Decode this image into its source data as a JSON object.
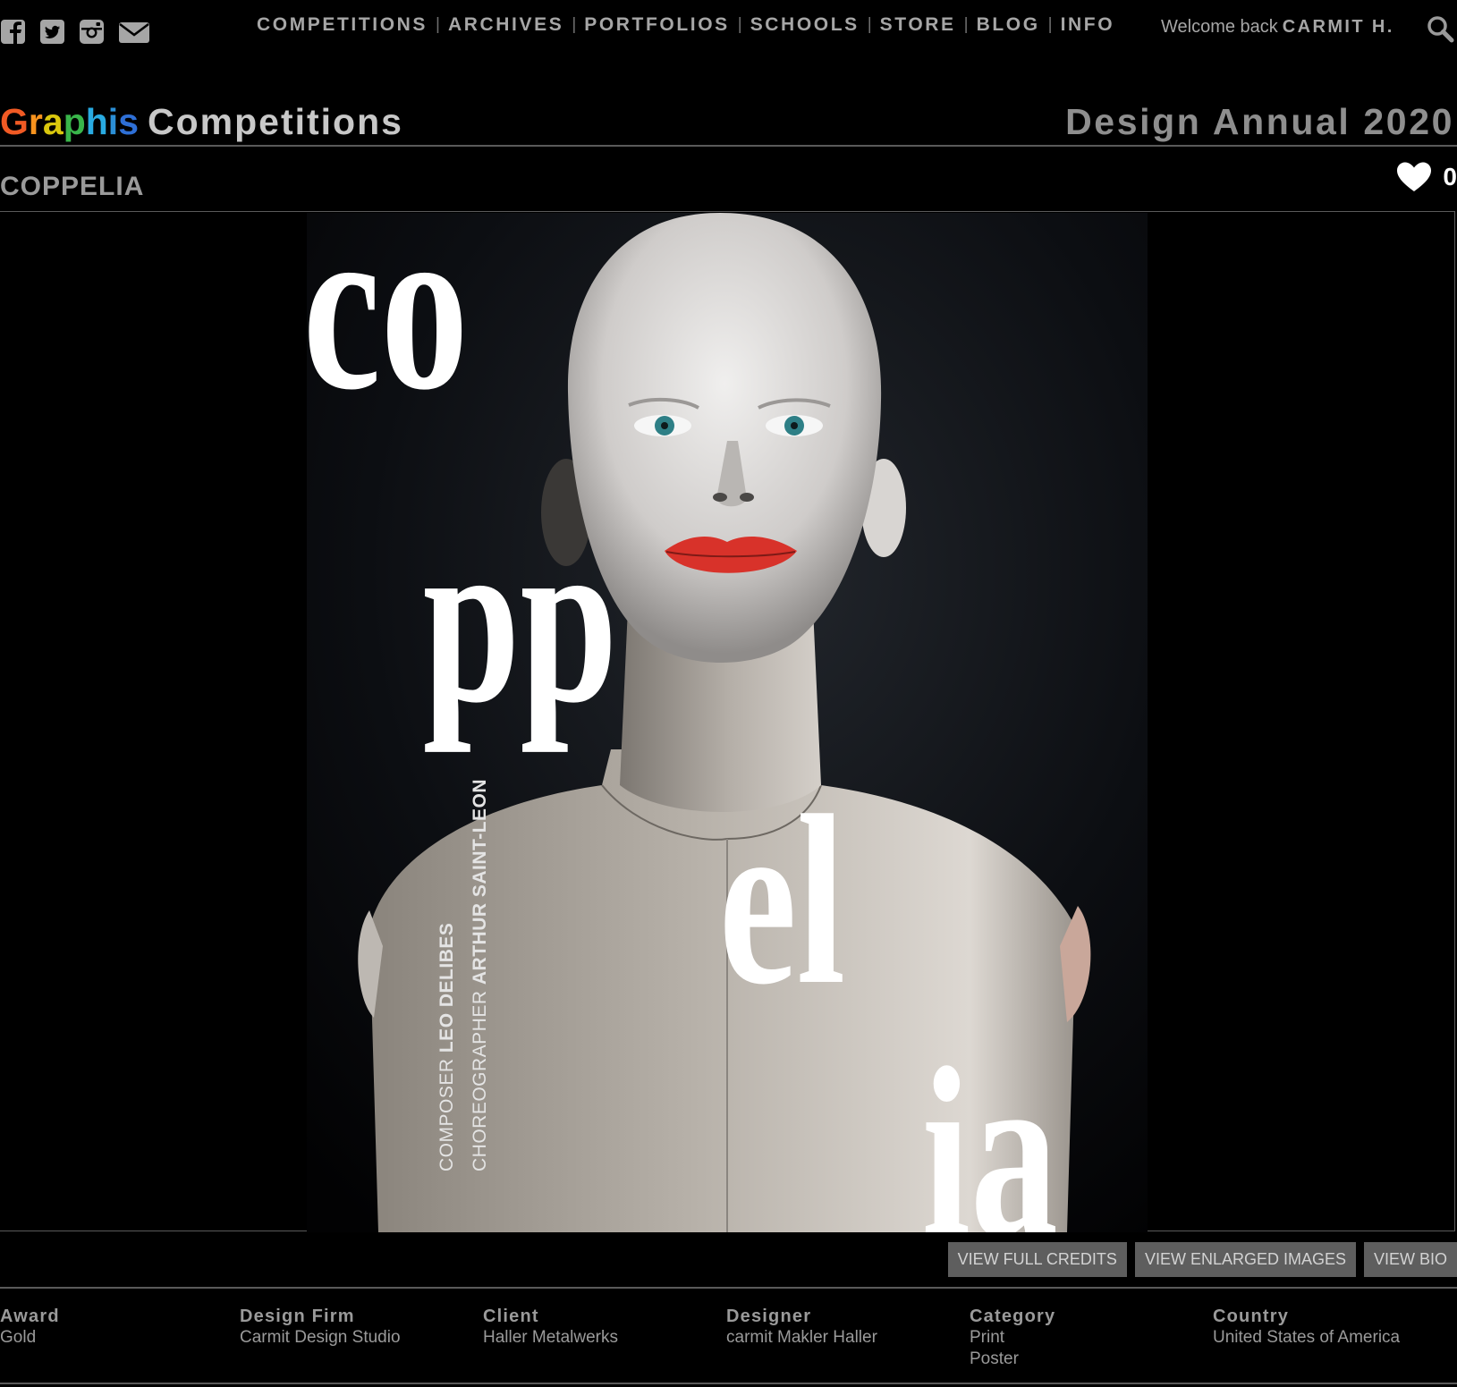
{
  "social": [
    {
      "name": "facebook-icon"
    },
    {
      "name": "twitter-icon"
    },
    {
      "name": "instagram-icon"
    },
    {
      "name": "email-icon"
    }
  ],
  "nav": {
    "items": [
      "COMPETITIONS",
      "ARCHIVES",
      "PORTFOLIOS",
      "SCHOOLS",
      "STORE",
      "BLOG",
      "INFO"
    ],
    "separator": "|",
    "welcome": "Welcome back",
    "user": "CARMIT H."
  },
  "header": {
    "brand_letters": [
      "G",
      "r",
      "a",
      "p",
      "h",
      "i",
      "s"
    ],
    "brand_colors": [
      "#f15a24",
      "#f7931e",
      "#d9c70d",
      "#39b54a",
      "#29abe2",
      "#2b8fd6",
      "#2e6fd6"
    ],
    "title": "Competitions",
    "annual": "Design Annual 2020"
  },
  "entry": {
    "title": "COPPELIA",
    "likes": "0"
  },
  "poster": {
    "letters": [
      "co",
      "pp",
      "el",
      "ia"
    ],
    "composer_label": "COMPOSER",
    "composer": "LEO DELIBES",
    "choreographer_label": "CHOREOGRAPHER",
    "choreographer": "ARTHUR SAINT-LEON",
    "lip_color": "#d8322a",
    "eye_color": "#2e7f86"
  },
  "buttons": {
    "full_credits": "VIEW FULL CREDITS",
    "enlarged": "VIEW ENLARGED IMAGES",
    "bio": "VIEW BIO"
  },
  "credits": [
    {
      "heading": "Award",
      "values": [
        "Gold"
      ]
    },
    {
      "heading": "Design Firm",
      "values": [
        "Carmit Design Studio"
      ]
    },
    {
      "heading": "Client",
      "values": [
        "Haller Metalwerks"
      ]
    },
    {
      "heading": "Designer",
      "values": [
        "carmit Makler Haller"
      ]
    },
    {
      "heading": "Category",
      "values": [
        "Print",
        "Poster"
      ]
    },
    {
      "heading": "Country",
      "values": [
        "United States of America"
      ]
    }
  ]
}
